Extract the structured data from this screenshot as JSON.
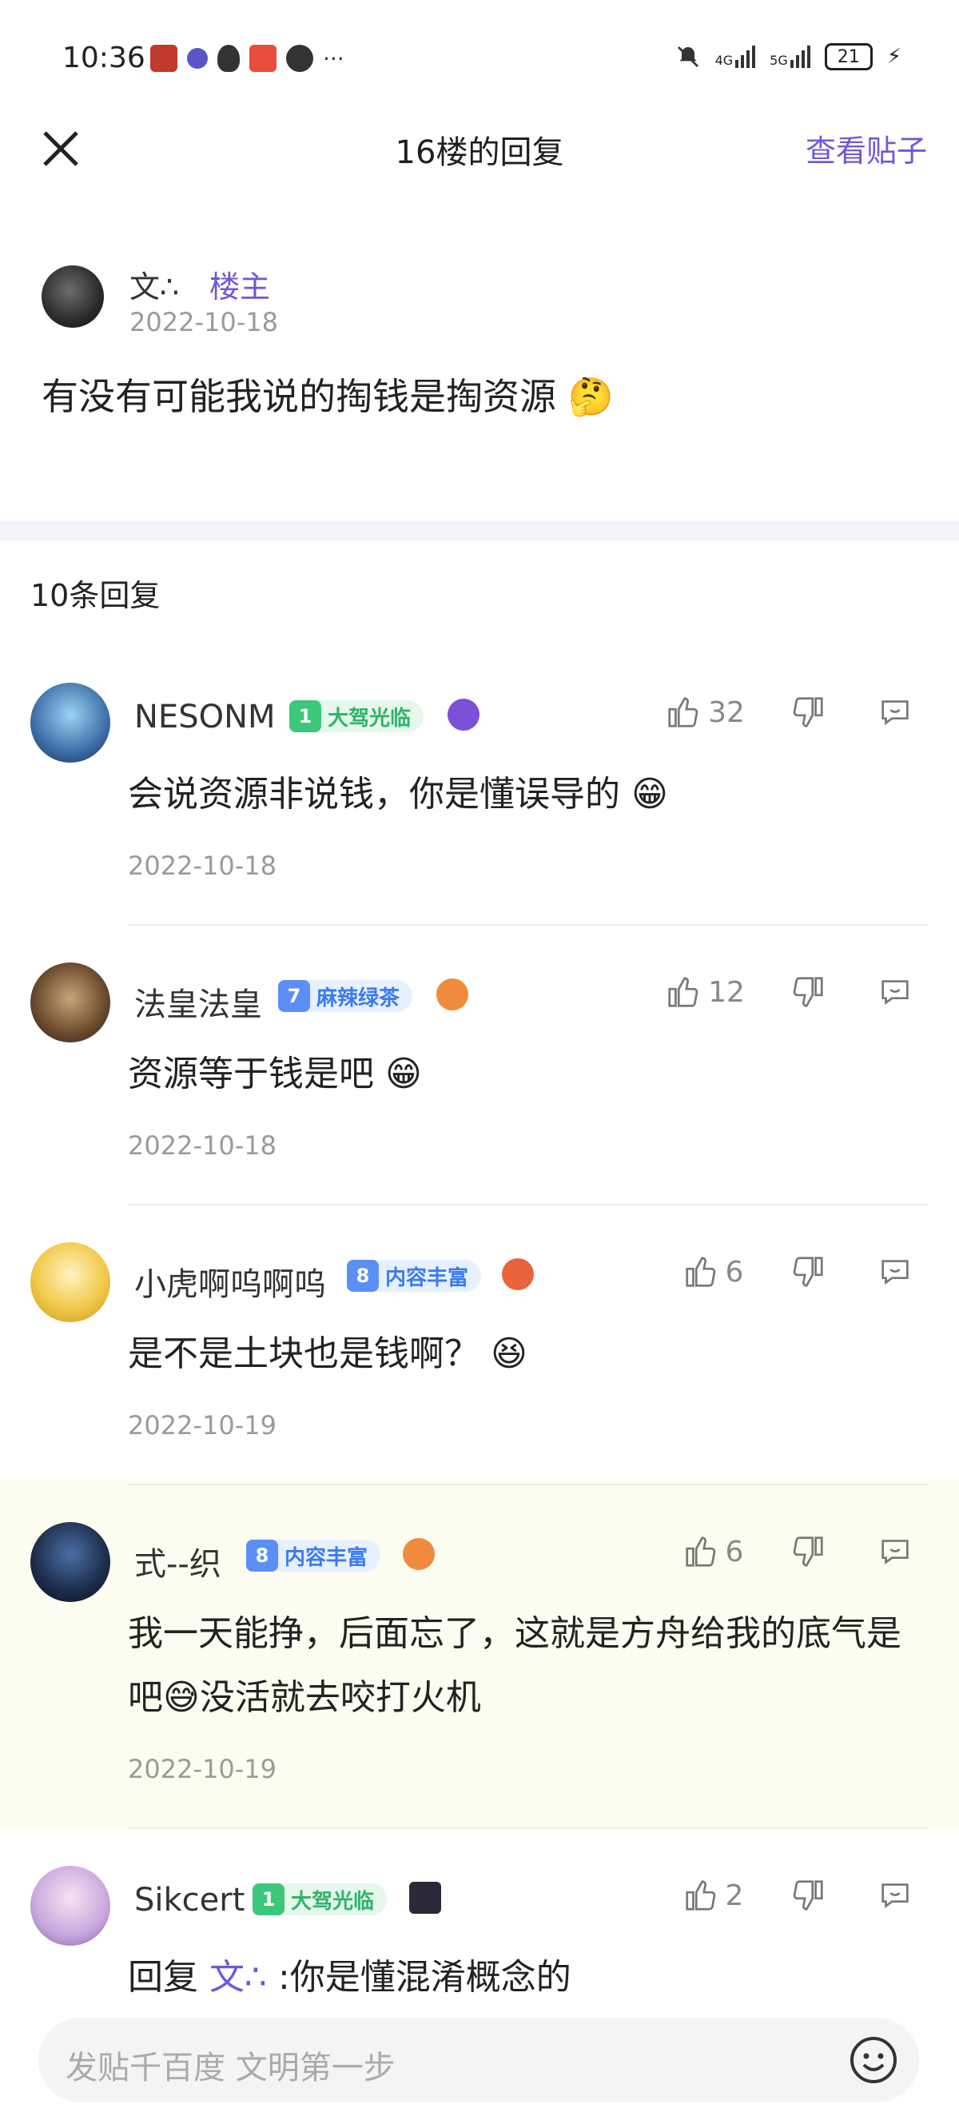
{
  "status_bar": {
    "time": "10:36",
    "network1": "4G",
    "network2": "5G",
    "battery": "21"
  },
  "header": {
    "title": "16楼的回复",
    "view_post": "查看贴子"
  },
  "op": {
    "name": "文∴",
    "tag": "楼主",
    "date": "2022-10-18",
    "text": "有没有可能我说的掏钱是掏资源 🤔"
  },
  "reply_count": "10条回复",
  "replies": [
    {
      "name": "NESONM",
      "level": "1",
      "badge": "大驾光临",
      "badge_color": "green",
      "likes": "32",
      "text": "会说资源非说钱，你是懂误导的 😁",
      "date": "2022-10-18"
    },
    {
      "name": "法皇法皇",
      "level": "7",
      "badge": "麻辣绿茶",
      "badge_color": "blue",
      "likes": "12",
      "text": "资源等于钱是吧 😁",
      "date": "2022-10-18"
    },
    {
      "name": "小虎啊呜啊呜",
      "level": "8",
      "badge": "内容丰富",
      "badge_color": "blue",
      "likes": "6",
      "text": "是不是土块也是钱啊？ 😆",
      "date": "2022-10-19"
    },
    {
      "name": "式--织",
      "level": "8",
      "badge": "内容丰富",
      "badge_color": "blue",
      "likes": "6",
      "text": "我一天能挣，后面忘了，这就是方舟给我的底气是吧😅没活就去咬打火机",
      "date": "2022-10-19"
    },
    {
      "name": "Sikcert",
      "level": "1",
      "badge": "大驾光临",
      "badge_color": "green",
      "likes": "2",
      "text_prefix": "回复 ",
      "text_mention": "文∴",
      "text_rest": " :你是懂混淆概念的"
    }
  ],
  "input": {
    "placeholder": "发贴千百度 文明第一步"
  }
}
